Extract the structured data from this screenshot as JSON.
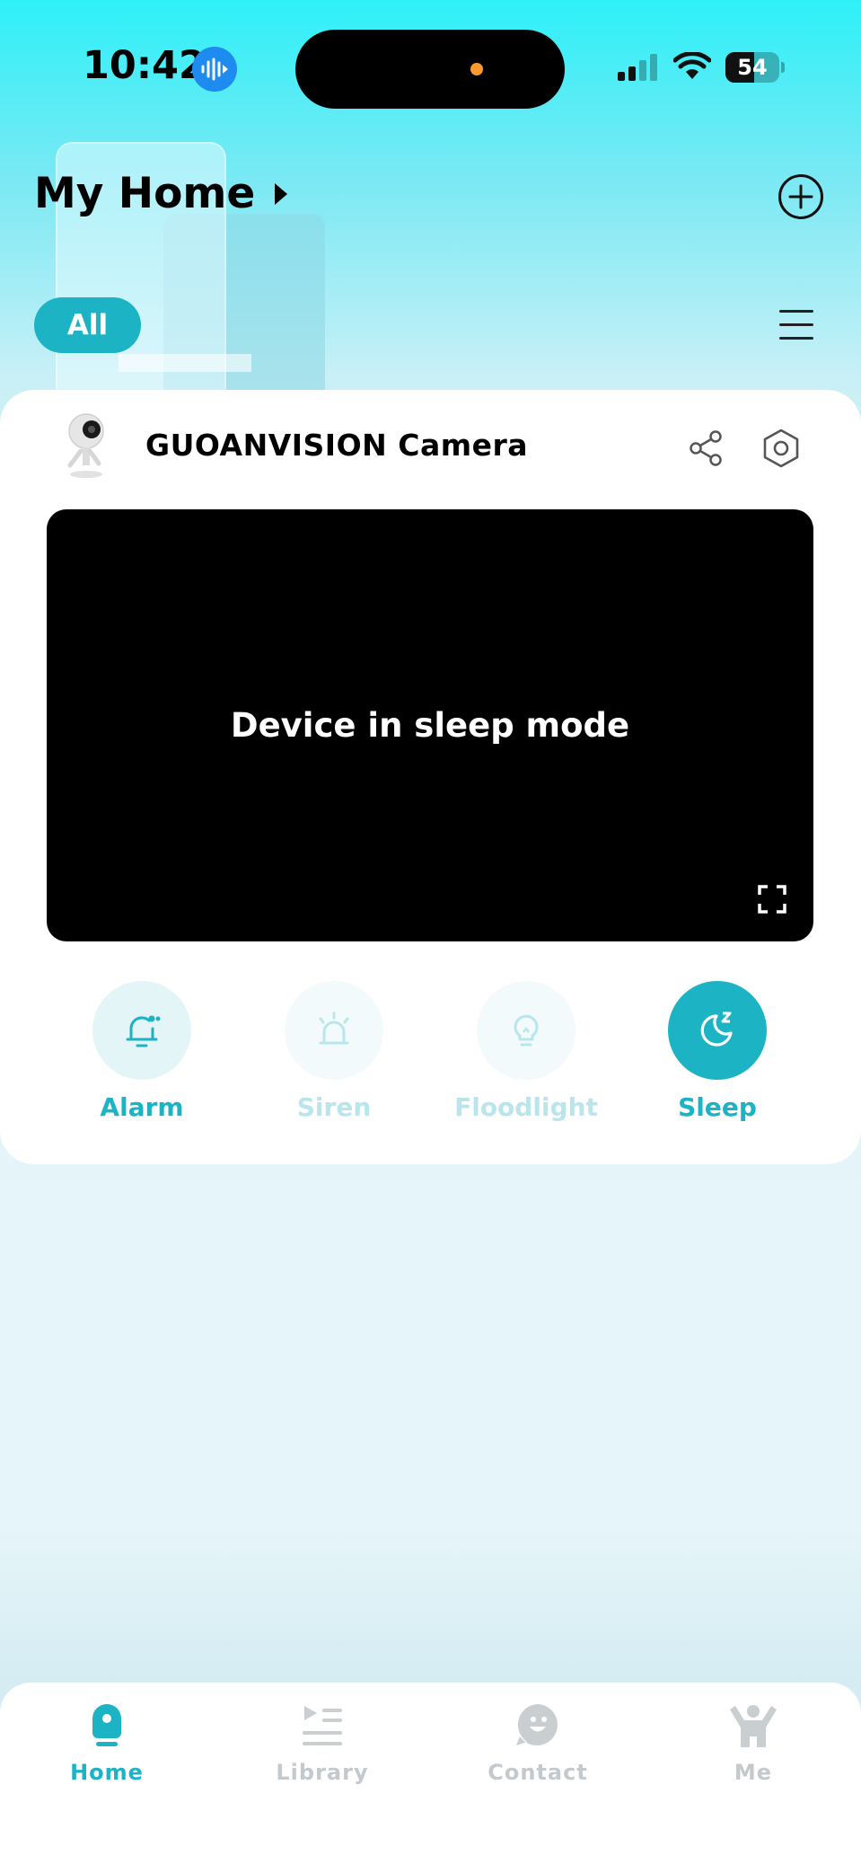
{
  "status_bar": {
    "time": "10:42",
    "battery": "54",
    "battery_level": 0.54
  },
  "header": {
    "title": "My Home",
    "filter_chip": "All"
  },
  "device": {
    "name": "GUOANVISION Camera",
    "video_message": "Device in sleep mode"
  },
  "controls": [
    {
      "label": "Alarm",
      "icon": "bell-icon",
      "state": "on"
    },
    {
      "label": "Siren",
      "icon": "siren-icon",
      "state": "disabled"
    },
    {
      "label": "Floodlight",
      "icon": "bulb-icon",
      "state": "disabled"
    },
    {
      "label": "Sleep",
      "icon": "moon-sleep-icon",
      "state": "active"
    }
  ],
  "bottom_nav": [
    {
      "label": "Home",
      "icon": "home-camera-icon",
      "active": true
    },
    {
      "label": "Library",
      "icon": "library-icon",
      "active": false
    },
    {
      "label": "Contact",
      "icon": "contact-icon",
      "active": false
    },
    {
      "label": "Me",
      "icon": "person-icon",
      "active": false
    }
  ],
  "colors": {
    "accent": "#1cb3c4",
    "accent_disabled": "#b9e6ec",
    "nav_inactive": "#c3c9cc"
  }
}
